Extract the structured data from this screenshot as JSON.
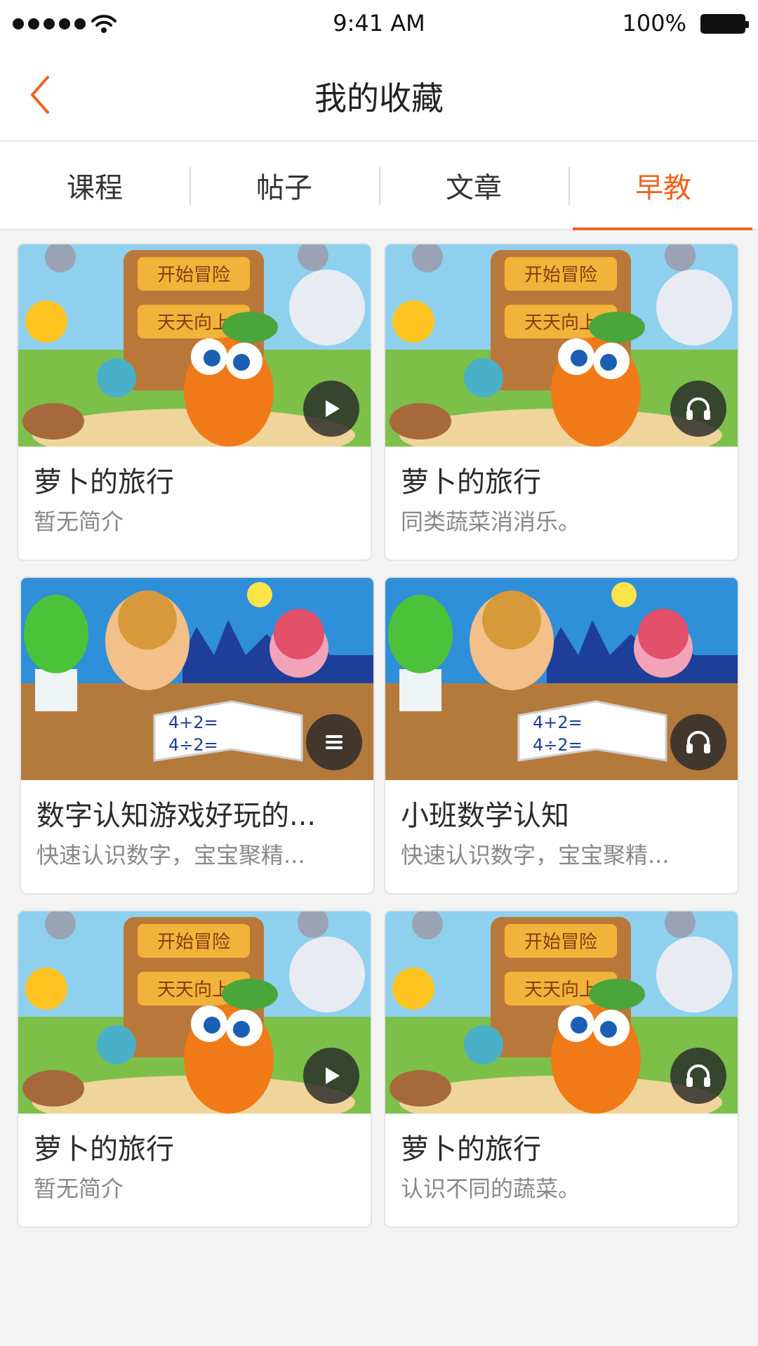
{
  "status_bar": {
    "time": "9:41 AM",
    "battery": "100%"
  },
  "nav": {
    "title": "我的收藏",
    "back_icon": "chevron-left-icon"
  },
  "tabs": [
    {
      "label": "课程",
      "active": false
    },
    {
      "label": "帖子",
      "active": false
    },
    {
      "label": "文章",
      "active": false
    },
    {
      "label": "早教",
      "active": true
    }
  ],
  "colors": {
    "accent": "#f0631f",
    "background": "#f3f3f3"
  },
  "cards": [
    {
      "title": "萝卜的旅行",
      "desc": "暂无简介",
      "image": "carrot-adventure",
      "media": "play-icon"
    },
    {
      "title": "萝卜的旅行",
      "desc": "同类蔬菜消消乐。",
      "image": "carrot-adventure",
      "media": "headphones-icon"
    },
    {
      "title": "数字认知游戏好玩的...",
      "desc": "快速认识数字，宝宝聚精...",
      "image": "kids-math",
      "media": "list-icon"
    },
    {
      "title": "小班数学认知",
      "desc": "快速认识数字，宝宝聚精...",
      "image": "kids-math",
      "media": "headphones-icon"
    },
    {
      "title": "萝卜的旅行",
      "desc": "暂无简介",
      "image": "carrot-adventure",
      "media": "play-icon"
    },
    {
      "title": "萝卜的旅行",
      "desc": "认识不同的蔬菜。",
      "image": "carrot-adventure",
      "media": "headphones-icon"
    }
  ],
  "illustrations": {
    "carrot_sign_top": "开始冒险",
    "carrot_sign_bottom": "天天向上",
    "math_line_1": "4+2=",
    "math_line_2": "4÷2="
  }
}
